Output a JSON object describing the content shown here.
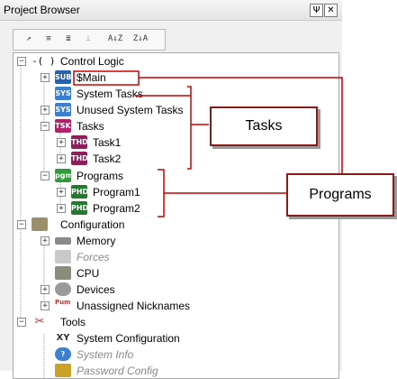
{
  "titlebar": {
    "title": "Project Browser",
    "pin_glyph": "Ψ",
    "close_glyph": "✕"
  },
  "toolbar": [
    "↗",
    "≡",
    "≣",
    "⊥",
    "A↓Z",
    "Z↓A"
  ],
  "tree": {
    "control_logic": "Control Logic",
    "control_logic_glyph": "-( )",
    "main": "$Main",
    "system_tasks": "System Tasks",
    "unused_system_tasks": "Unused System Tasks",
    "tasks": "Tasks",
    "task1": "Task1",
    "task2": "Task2",
    "programs": "Programs",
    "program1": "Program1",
    "program2": "Program2",
    "configuration": "Configuration",
    "memory": "Memory",
    "forces": "Forces",
    "cpu": "CPU",
    "devices": "Devices",
    "unassigned_nicknames": "Unassigned Nicknames",
    "tools": "Tools",
    "system_configuration": "System Configuration",
    "system_info": "System Info",
    "password_config": "Password Config"
  },
  "icons": {
    "sub": "SUB",
    "sys": "SYS",
    "tsk": "TSK",
    "thd": "THD",
    "pgm": "pgm",
    "phd": "PHD",
    "xy": "XY",
    "pump": "Pump"
  },
  "callouts": {
    "tasks": "Tasks",
    "programs": "Programs"
  },
  "colors": {
    "callout_border": "#8b1a1a",
    "annotation_line": "#cc0000"
  }
}
